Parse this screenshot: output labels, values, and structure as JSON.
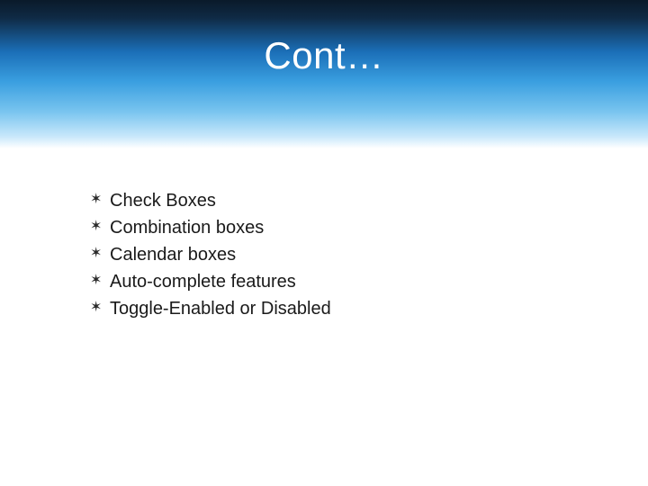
{
  "slide": {
    "title": "Cont…",
    "bullets": [
      {
        "text": "Check Boxes"
      },
      {
        "text": "Combination boxes"
      },
      {
        "text": "Calendar boxes"
      },
      {
        "text": "Auto-complete features"
      },
      {
        "text": "Toggle-Enabled or Disabled"
      }
    ],
    "bullet_glyph": "✶"
  }
}
